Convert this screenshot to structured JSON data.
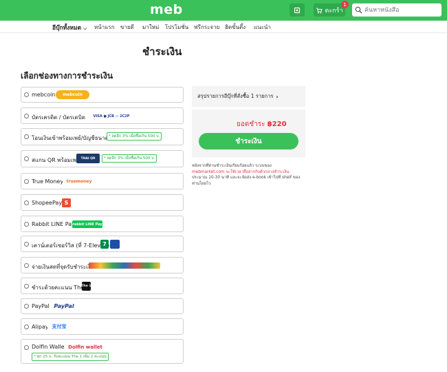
{
  "header": {
    "logo": "meb",
    "cart_label": "ตะกร้า",
    "cart_count": "1",
    "search_placeholder": "ค้นหาหนังสือ"
  },
  "nav": {
    "category": "อีบุ๊กทั้งหมด",
    "items": [
      "หน้าแรก",
      "ขายดี",
      "มาใหม่",
      "โปรโมชั่น",
      "ฟรีกระจาย",
      "ฮิตขั้นตึ้ง",
      "แนะนำ"
    ]
  },
  "page": {
    "title": "ชำระเงิน",
    "section_title": "เลือกช่องทางการชำระเงิน"
  },
  "payment_options": [
    {
      "label": "mebcoin",
      "logo": "mebcoin"
    },
    {
      "label": "บัตรเครดิต / บัตรเดบิต",
      "logo": "VISA ● JCB ▭ 2C2P"
    },
    {
      "label": "โอนเงินเข้าพร้อมเพย์/บัญชีธนาคาร",
      "promo": "* ลดอีก 3% เมื่อซื้อเกิน 500 บ."
    },
    {
      "label": "สแกน QR พร้อมเพย์",
      "logo": "THAI QR",
      "promo": "* ลดอีก 3% เมื่อซื้อเกิน 500 บ."
    },
    {
      "label": "True Money",
      "logo": "truemoney"
    },
    {
      "label": "ShopeePay",
      "logo": "S"
    },
    {
      "label": "Rabbit LINE Pay",
      "logo": "rabbit LINE Pay"
    },
    {
      "label": "เคาน์เตอร์เซอร์วิส (ที่ 7-Eleven)",
      "logo": "7"
    },
    {
      "label": "จ่ายเงินสดที่จุดรับชำระเงิน",
      "logo": "counter"
    },
    {
      "label": "ชำระด้วยคะแนน The 1",
      "logo": "The 1"
    },
    {
      "label": "PayPal",
      "logo": "PayPal"
    },
    {
      "label": "Alipay",
      "logo": "支付宝"
    },
    {
      "label": "Dolfin Wallet",
      "logo": "Dolfin wallet",
      "promo": "* ทุก 25 บ. รับคะแนน The 1 เพิ่ม 2 คะแนน"
    }
  ],
  "summary": {
    "row_label": "สรุปรายการอีบุ๊กที่สั่งซื้อ 1 รายการ",
    "total_label": "ยอดชำระ",
    "total_value": "฿220",
    "pay_button": "ชำระเงิน",
    "note_1": "หลังจากที่ท่านชำระเงินเรียบร้อยแล้ว ระบบของ",
    "note_2": "mebmarket.com จะใช้เวลาสื่อสารกับตัวกลางชำระเงิน",
    "note_3": "ประมาณ 10-30 นาที และจะจัดส่ง e-book เข้าไปที่ shelf ของ",
    "note_4": "ท่านโดยไว"
  },
  "colors": {
    "brand": "#3bc15a",
    "price": "#e0303c"
  }
}
